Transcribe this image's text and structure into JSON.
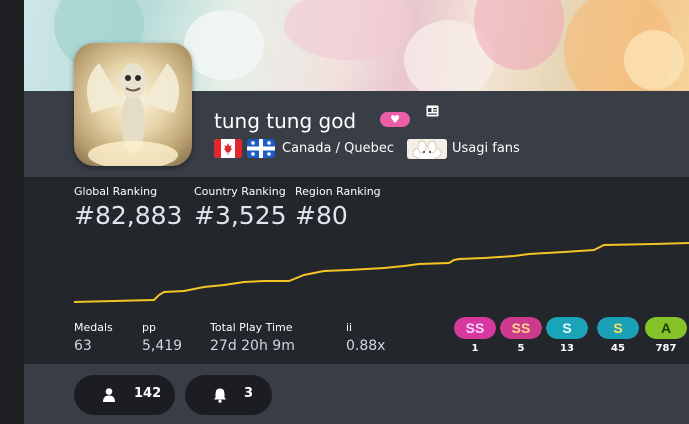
{
  "profile": {
    "username": "tung tung god",
    "supporter_icon": "heart-icon",
    "card_icon": "profile-card-icon",
    "country_flag": "canada-flag",
    "region_flag": "quebec-flag",
    "location": "Canada / Quebec",
    "team_flag": "usagi-fans-team-flag",
    "team_name": "Usagi fans"
  },
  "rankings": [
    {
      "label": "Global Ranking",
      "value": "#82,883"
    },
    {
      "label": "Country Ranking",
      "value": "#3,525"
    },
    {
      "label": "Region Ranking",
      "value": "#80"
    }
  ],
  "stats": [
    {
      "label": "Medals",
      "value": "63"
    },
    {
      "label": "pp",
      "value": "5,419"
    },
    {
      "label": "Total Play Time",
      "value": "27d 20h 9m"
    },
    {
      "label": "ii",
      "value": "0.88x"
    }
  ],
  "grades": [
    {
      "grade": "SS",
      "count": "1",
      "color": "#d6389e",
      "text_color": "#f5d6ff"
    },
    {
      "grade": "SS",
      "count": "5",
      "color": "#cc3a8c",
      "text_color": "#ffd58a"
    },
    {
      "grade": "S",
      "count": "13",
      "color": "#1ba4b8",
      "text_color": "#e9faff"
    },
    {
      "grade": "S",
      "count": "45",
      "color": "#1aa1b5",
      "text_color": "#ffdf68"
    },
    {
      "grade": "A",
      "count": "787",
      "color": "#86c22a",
      "text_color": "#1f3b00"
    }
  ],
  "social": {
    "followers_icon": "user-icon",
    "followers": "142",
    "subscribers_icon": "bell-icon",
    "subscribers": "3"
  },
  "colors": {
    "accent_graph": "#f5c425",
    "supporter_pink": "#ec5ea8",
    "background": "#23262b",
    "band": "#393d45"
  }
}
